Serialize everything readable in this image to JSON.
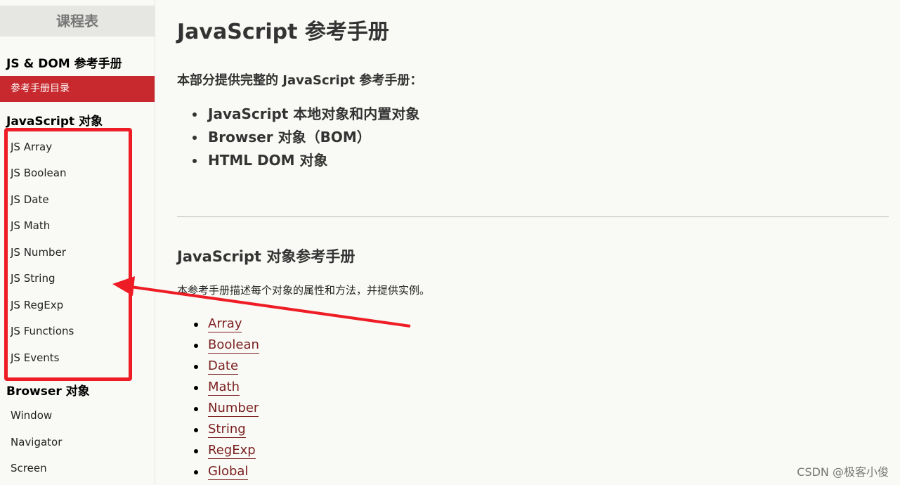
{
  "sidebar": {
    "heading": "课程表",
    "section1_title": "JS & DOM 参考手册",
    "active_item": "参考手册目录",
    "section2_title": "JavaScript 对象",
    "js_items": [
      "JS Array",
      "JS Boolean",
      "JS Date",
      "JS Math",
      "JS Number",
      "JS String",
      "JS RegExp",
      "JS Functions",
      "JS Events"
    ],
    "section3_title": "Browser 对象",
    "browser_items": [
      "Window",
      "Navigator",
      "Screen"
    ]
  },
  "main": {
    "title": "JavaScript 参考手册",
    "intro": "本部分提供完整的 JavaScript 参考手册：",
    "bullets": [
      "JavaScript 本地对象和内置对象",
      "Browser 对象（BOM）",
      "HTML DOM 对象"
    ],
    "section2_title": "JavaScript 对象参考手册",
    "section2_desc": "本参考手册描述每个对象的属性和方法，并提供实例。",
    "links": [
      "Array",
      "Boolean",
      "Date",
      "Math",
      "Number",
      "String",
      "RegExp",
      "Global"
    ]
  },
  "annotation": {
    "color": "#ee1c25"
  },
  "watermark": "CSDN @极客小俊",
  "colors": {
    "accent": "#c7292e",
    "link": "#7a1f1f"
  }
}
